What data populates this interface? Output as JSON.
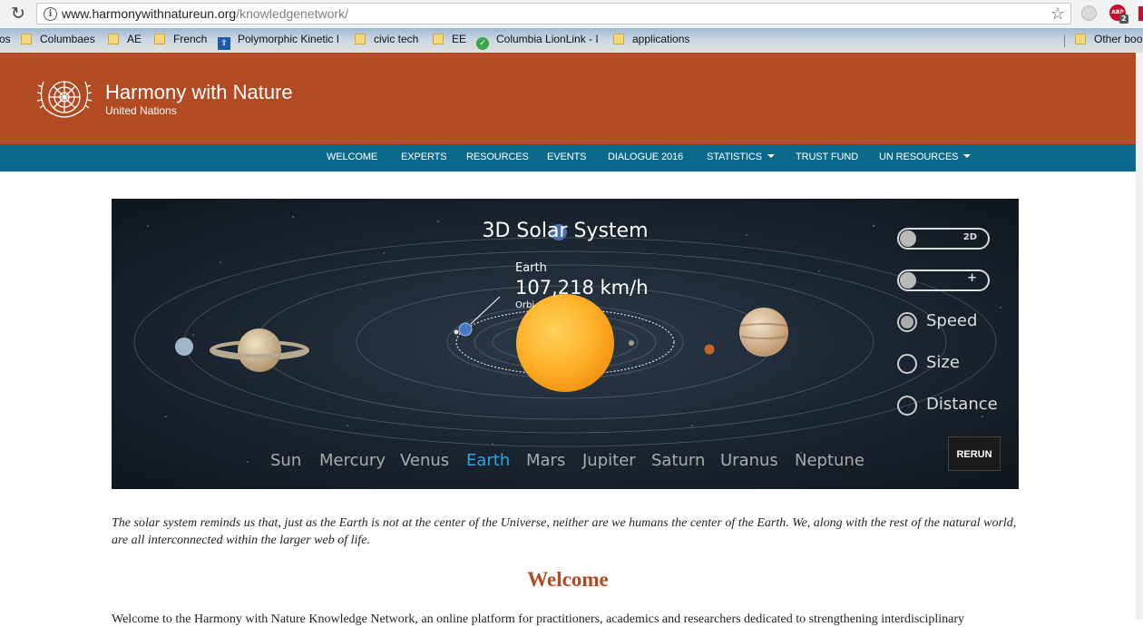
{
  "browser": {
    "url_host": "www.harmonywithnatureun.org",
    "url_path": "/knowledgenetwork/",
    "extension_badge": "2",
    "extension_label": "ABP",
    "bookmarks": [
      {
        "label": "os",
        "icon": "none"
      },
      {
        "label": "Columbaes",
        "icon": "folder-icon"
      },
      {
        "label": "AE",
        "icon": "folder-icon"
      },
      {
        "label": "French",
        "icon": "folder-icon"
      },
      {
        "label": "Polymorphic Kinetic I",
        "icon": "site-icon"
      },
      {
        "label": "civic tech",
        "icon": "folder-icon"
      },
      {
        "label": "EE",
        "icon": "folder-icon"
      },
      {
        "label": "Columbia LionLink - I",
        "icon": "lion-icon"
      },
      {
        "label": "applications",
        "icon": "folder-icon"
      },
      {
        "label": "Other boo",
        "icon": "folder-icon"
      }
    ]
  },
  "header": {
    "title": "Harmony with Nature",
    "subtitle": "United Nations",
    "color": "#b24a24"
  },
  "nav": {
    "color": "#0b6a8b",
    "items": [
      "WELCOME",
      "EXPERTS",
      "RESOURCES",
      "EVENTS",
      "DIALOGUE 2016",
      "STATISTICS",
      "TRUST FUND",
      "UN RESOURCES"
    ]
  },
  "solar": {
    "title": "3D Solar System",
    "selected_planet": "Earth",
    "speed": "107,218 km/h",
    "orbit_label": "Orbi",
    "toggle_view": "2D",
    "toggle_zoom": "+",
    "radio_options": [
      "Speed",
      "Size",
      "Distance"
    ],
    "radio_selected": "Speed",
    "rerun_label": "RERUN",
    "planets": [
      "Sun",
      "Mercury",
      "Venus",
      "Earth",
      "Mars",
      "Jupiter",
      "Saturn",
      "Uranus",
      "Neptune"
    ],
    "active_color": "#29a8e0"
  },
  "content": {
    "caption": "The solar system reminds us that, just as the Earth is not at the center of the Universe, neither are we humans the center of the Earth. We, along with the rest of the natural world, are all interconnected within the larger web of life.",
    "welcome_heading": "Welcome",
    "welcome_text": "Welcome to the Harmony with Nature Knowledge Network, an online platform for practitioners, academics and researchers dedicated to strengthening interdisciplinary"
  }
}
